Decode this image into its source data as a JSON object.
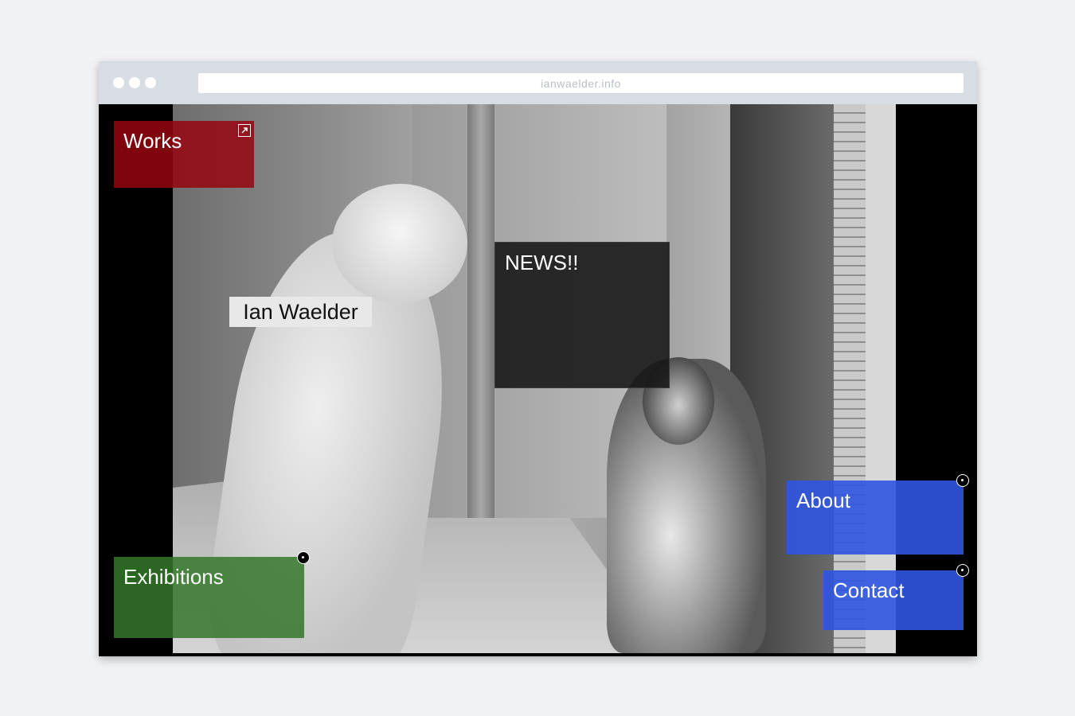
{
  "browser": {
    "url": "ianwaelder.info"
  },
  "icons": {
    "window_dots": "window-dots-icon",
    "external_link": "external-link-icon",
    "target": "target-icon"
  },
  "colors": {
    "works": "#960510",
    "news": "#141414",
    "exhibitions": "#327828",
    "about": "#2d55e1",
    "contact": "#2d55e1"
  },
  "page": {
    "works_label": "Works",
    "news_label": "NEWS!!",
    "artist_name": "Ian Waelder",
    "exhibitions_label": "Exhibitions",
    "about_label": "About",
    "contact_label": "Contact"
  }
}
